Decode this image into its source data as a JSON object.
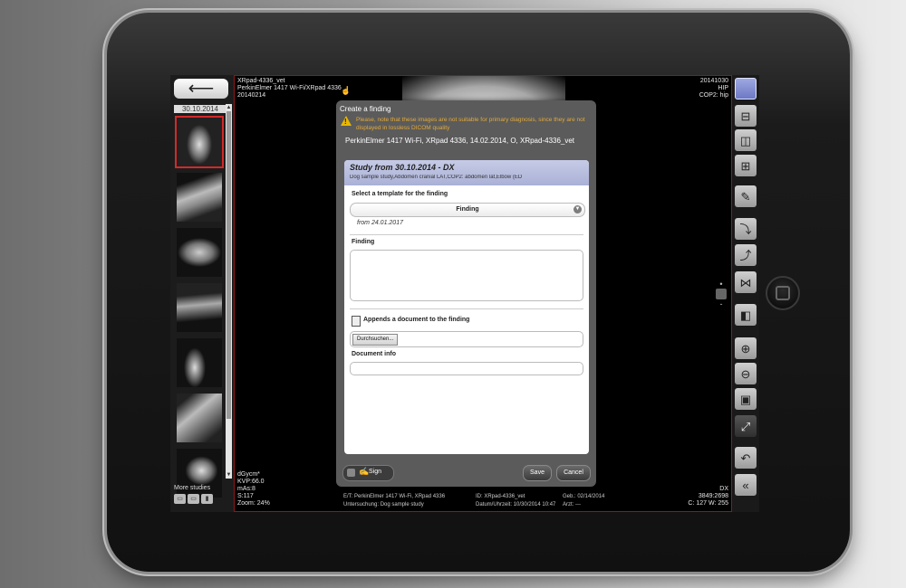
{
  "sidebar": {
    "back_icon": "left-arrow-icon",
    "back_glyph": "⟵",
    "thumb_date": "30.10.2014",
    "thumbnails": [
      "hip",
      "spine-lateral",
      "abdomen",
      "spine",
      "knee-marked",
      "elbow",
      "tarsus"
    ],
    "more_studies": "More studies"
  },
  "viewer": {
    "top_left": "XRpad-4336_vet\nPerkinElmer 1417 Wi-Fi/XRpad 4336\n20140214",
    "top_right": "20141030\nHIP\nCOP2: hip",
    "bottom_left": "dGycm*\nKVP:66.0\nmAs:8\nS:117\nZoom: 24%",
    "bottom_right": "DX\n3849:2698\nC: 127 W: 255",
    "info": {
      "r1c1": "E/T: PerkinElmer 1417 Wi-Fi, XRpad 4336",
      "r1c2": "ID: XRpad-4336_vet",
      "r1c3": "Geb.: 02/14/2014",
      "r2c1": "Untersuchung: Dog sample study",
      "r2c2": "Datum/Uhrzeit: 10/30/2014 10:47",
      "r2c3": "Arzt: ---"
    }
  },
  "toolbar": {
    "tools": [
      "layout-1x1-icon",
      "layout-2h-icon",
      "layout-2v-icon",
      "layout-2x2-icon",
      "pen-icon",
      "rotate-90-icon",
      "rotate-90-ccw-icon",
      "flip-icon",
      "invert-icon",
      "zoom-in-icon",
      "zoom-out-icon",
      "fit-icon",
      "fullscreen-icon",
      "undo-icon",
      "collapse-icon"
    ]
  },
  "dialog": {
    "title": "Create a finding",
    "warning": "Please, note that these images are not suitable for primary diagnosis, since they are not displayed in lossless DICOM quality",
    "patient": "PerkinElmer 1417 Wi-Fi, XRpad 4336, 14.02.2014, O, XRpad-4336_vet",
    "study_title": "Study from 30.10.2014 - DX",
    "study_sub": "Dog sample study,Abdomen cranial LAT,COP2: abdomen lat,Elbow (ED",
    "template_label": "Select a template for the finding",
    "template_value": "Finding",
    "template_from": "from 24.01.2017",
    "finding_label": "Finding",
    "append_label": "Appends a document to the finding",
    "browse_label": "Durchsuchen...",
    "docinfo_label": "Document info",
    "sign_label": "Sign",
    "save_label": "Save",
    "cancel_label": "Cancel"
  }
}
